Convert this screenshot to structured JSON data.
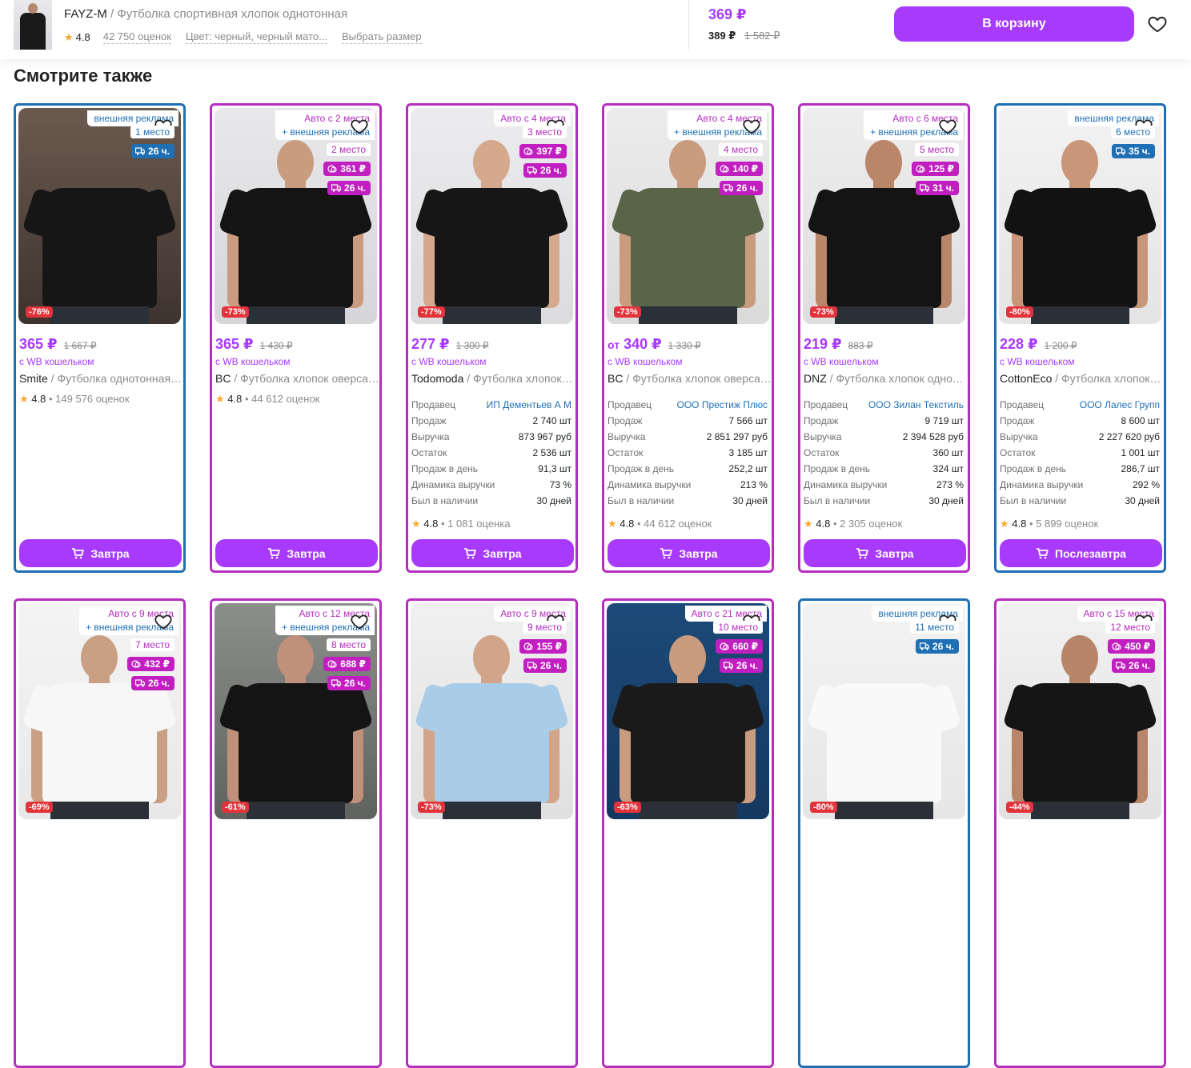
{
  "header": {
    "brand": "FAYZ-M",
    "separator": " / ",
    "product_name": "Футболка спортивная хлопок однотонная",
    "rating": "4.8",
    "reviews": "42 750 оценок",
    "color": "Цвет: черный, черный мато...",
    "choose_size": "Выбрать размер",
    "price": "369 ₽",
    "price_wallet": "389 ₽",
    "price_old": "1 582 ₽",
    "cart_button": "В корзину"
  },
  "section_title": "Смотрите также",
  "stat_labels": {
    "seller": "Продавец",
    "sales": "Продаж",
    "revenue": "Выручка",
    "stock": "Остаток",
    "per_day": "Продаж в день",
    "dynamics": "Динамика выручки",
    "in_stock": "Был в наличии"
  },
  "cards": [
    {
      "ad_auto": "",
      "ad_ext": "внешняя реклама",
      "place": "1 место",
      "bid": "",
      "delivery_time": "26 ч.",
      "discount": "-76%",
      "price": "365 ₽",
      "old_price": "1 667 ₽",
      "wallet": "с WB кошельком",
      "brand": "Smite",
      "name": " / Футболка однотонная оверсайз",
      "rating": "4.8",
      "reviews": "149 576 оценок",
      "stats": null,
      "button": "Завтра"
    },
    {
      "ad_auto": "Авто с 2 места",
      "ad_ext": "+ внешняя реклама",
      "place": "2 место",
      "bid": "361 ₽",
      "delivery_time": "26 ч.",
      "discount": "-73%",
      "price": "365 ₽",
      "old_price": "1 430 ₽",
      "wallet": "с WB кошельком",
      "brand": "BC",
      "name": " / Футболка хлопок оверсайз",
      "rating": "4.8",
      "reviews": "44 612 оценок",
      "stats": null,
      "button": "Завтра"
    },
    {
      "ad_auto": "Авто с 4 места",
      "ad_ext": "",
      "place": "3 место",
      "bid": "397 ₽",
      "delivery_time": "26 ч.",
      "discount": "-77%",
      "price": "277 ₽",
      "old_price": "1 300 ₽",
      "wallet": "с WB кошельком",
      "brand": "Todomoda",
      "name": " / Футболка хлопок однотонная",
      "rating": "4.8",
      "reviews": "1 081 оценка",
      "stats": {
        "seller": "ИП Дементьев А М",
        "sales": "2 740 шт",
        "revenue": "873 967 руб",
        "stock": "2 536 шт",
        "per_day": "91,3 шт",
        "dynamics": "73 %",
        "in_stock": "30 дней"
      },
      "button": "Завтра"
    },
    {
      "ad_auto": "Авто с 4 места",
      "ad_ext": "+ внешняя реклама",
      "place": "4 место",
      "bid": "140 ₽",
      "delivery_time": "26 ч.",
      "discount": "-73%",
      "price_from": "от",
      "price": "340 ₽",
      "old_price": "1 330 ₽",
      "wallet": "с WB кошельком",
      "brand": "BC",
      "name": " / Футболка хлопок оверсайз",
      "rating": "4.8",
      "reviews": "44 612 оценок",
      "stats": {
        "seller": "ООО Престиж Плюс",
        "sales": "7 566 шт",
        "revenue": "2 851 297 руб",
        "stock": "3 185 шт",
        "per_day": "252,2 шт",
        "dynamics": "213 %",
        "in_stock": "30 дней"
      },
      "button": "Завтра"
    },
    {
      "ad_auto": "Авто с 6 места",
      "ad_ext": "+ внешняя реклама",
      "place": "5 место",
      "bid": "125 ₽",
      "delivery_time": "31 ч.",
      "discount": "-73%",
      "price": "219 ₽",
      "old_price": "883 ₽",
      "wallet": "с WB кошельком",
      "brand": "DNZ",
      "name": " / Футболка хлопок однотонная",
      "rating": "4.8",
      "reviews": "2 305 оценок",
      "stats": {
        "seller": "ООО Зилан Текстиль",
        "sales": "9 719 шт",
        "revenue": "2 394 528 руб",
        "stock": "360 шт",
        "per_day": "324 шт",
        "dynamics": "273 %",
        "in_stock": "30 дней"
      },
      "button": "Завтра"
    },
    {
      "ad_auto": "",
      "ad_ext": "внешняя реклама",
      "place": "6 место",
      "bid": "",
      "delivery_time": "35 ч.",
      "discount": "-80%",
      "price": "228 ₽",
      "old_price": "1 200 ₽",
      "wallet": "с WB кошельком",
      "brand": "CottonEco",
      "name": " / Футболка хлопок однотонная",
      "rating": "4.8",
      "reviews": "5 899 оценок",
      "stats": {
        "seller": "ООО Лалес Групп",
        "sales": "8 600 шт",
        "revenue": "2 227 620 руб",
        "stock": "1 001 шт",
        "per_day": "286,7 шт",
        "dynamics": "292 %",
        "in_stock": "30 дней"
      },
      "button": "Послезавтра"
    },
    {
      "ad_auto": "Авто с 9 места",
      "ad_ext": "+ внешняя реклама",
      "place": "7 место",
      "bid": "432 ₽",
      "delivery_time": "26 ч.",
      "discount": "-69%"
    },
    {
      "ad_auto": "Авто с 12 места",
      "ad_ext": "+ внешняя реклама",
      "place": "8 место",
      "bid": "688 ₽",
      "delivery_time": "26 ч.",
      "discount": "-61%"
    },
    {
      "ad_auto": "Авто с 9 места",
      "ad_ext": "",
      "place": "9 место",
      "bid": "155 ₽",
      "delivery_time": "26 ч.",
      "discount": "-73%"
    },
    {
      "ad_auto": "Авто с 21 места",
      "ad_ext": "",
      "place": "10 место",
      "bid": "660 ₽",
      "delivery_time": "26 ч.",
      "discount": "-63%"
    },
    {
      "ad_auto": "",
      "ad_ext": "внешняя реклама",
      "place": "11 место",
      "bid": "",
      "delivery_time": "26 ч.",
      "discount": "-80%"
    },
    {
      "ad_auto": "Авто с 15 места",
      "ad_ext": "",
      "place": "12 место",
      "bid": "450 ₽",
      "delivery_time": "26 ч.",
      "discount": "-44%"
    }
  ]
}
